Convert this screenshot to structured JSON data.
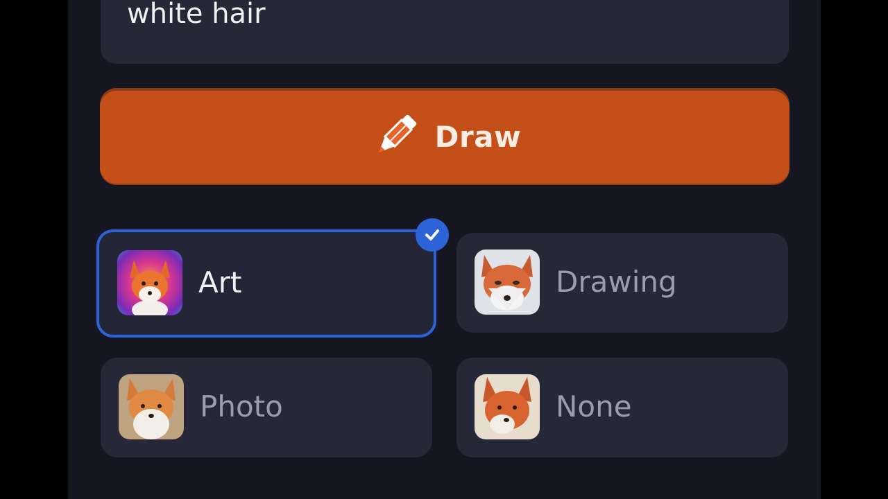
{
  "prompt": {
    "text": "white hair"
  },
  "draw_button": {
    "label": "Draw",
    "icon": "pencil-icon",
    "color": "#c54f19"
  },
  "styles": {
    "selected": "Art",
    "accent": "#2c63d6",
    "items": [
      {
        "label": "Art",
        "thumbnail": "fox-art-thumbnail",
        "selected": true
      },
      {
        "label": "Drawing",
        "thumbnail": "fox-drawing-thumbnail",
        "selected": false
      },
      {
        "label": "Photo",
        "thumbnail": "fox-photo-thumbnail",
        "selected": false
      },
      {
        "label": "None",
        "thumbnail": "fox-none-thumbnail",
        "selected": false
      }
    ]
  }
}
